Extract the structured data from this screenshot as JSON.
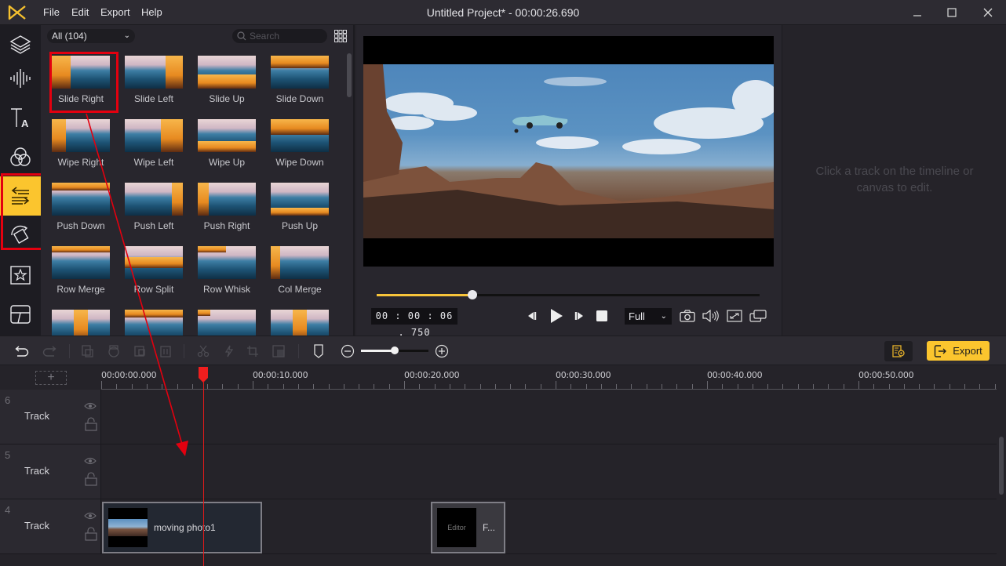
{
  "app": {
    "title": "Untitled Project* - 00:00:26.690",
    "menu": [
      "File",
      "Edit",
      "Export",
      "Help"
    ],
    "window_controls": [
      "minimize",
      "maximize",
      "close"
    ],
    "accent_color": "#fbc52e",
    "highlight_color": "#e3000f"
  },
  "sidebar": {
    "items": [
      {
        "name": "media",
        "icon": "layers-icon",
        "active": false
      },
      {
        "name": "audio",
        "icon": "audio-wave-icon",
        "active": false
      },
      {
        "name": "text",
        "icon": "text-icon",
        "active": false
      },
      {
        "name": "filters",
        "icon": "filters-icon",
        "active": false
      },
      {
        "name": "transitions",
        "icon": "transitions-icon",
        "active": true
      },
      {
        "name": "motion",
        "icon": "motion-icon",
        "active": false
      },
      {
        "name": "elements",
        "icon": "star-icon",
        "active": false
      },
      {
        "name": "templates",
        "icon": "template-icon",
        "active": false
      }
    ]
  },
  "library": {
    "filter": "All (104)",
    "search_placeholder": "Search",
    "selected": "Slide Right",
    "transitions": [
      "Slide Right",
      "Slide Left",
      "Slide Up",
      "Slide Down",
      "Wipe Right",
      "Wipe Left",
      "Wipe Up",
      "Wipe Down",
      "Push Down",
      "Push Left",
      "Push Right",
      "Push Up",
      "Row Merge",
      "Row Split",
      "Row Whisk",
      "Col Merge",
      "",
      "",
      "",
      ""
    ]
  },
  "preview": {
    "timecode": "00 : 00 : 06 . 750",
    "progress": 0.25,
    "quality": "Full",
    "controls": [
      "prev-frame",
      "play",
      "next-frame",
      "stop"
    ],
    "tools": [
      "snapshot",
      "volume",
      "fullscreen",
      "pop-out"
    ]
  },
  "properties": {
    "hint": "Click a track on the timeline or canvas to edit."
  },
  "toolbar": {
    "export_label": "Export",
    "zoom_level": 0.5
  },
  "timeline": {
    "ruler_labels": [
      "00:00:00.000",
      "00:00:10.000",
      "00:00:20.000",
      "00:00:30.000",
      "00:00:40.000",
      "00:00:50.000"
    ],
    "playhead_time": "00:00:06.750",
    "tracks": [
      {
        "number": "6",
        "name": "Track",
        "clips": []
      },
      {
        "number": "5",
        "name": "Track",
        "clips": []
      },
      {
        "number": "4",
        "name": "Track",
        "clips": [
          {
            "label": "moving photo1",
            "thumb_text": ""
          },
          {
            "label": "F...",
            "thumb_text": "Editor"
          }
        ]
      }
    ]
  }
}
